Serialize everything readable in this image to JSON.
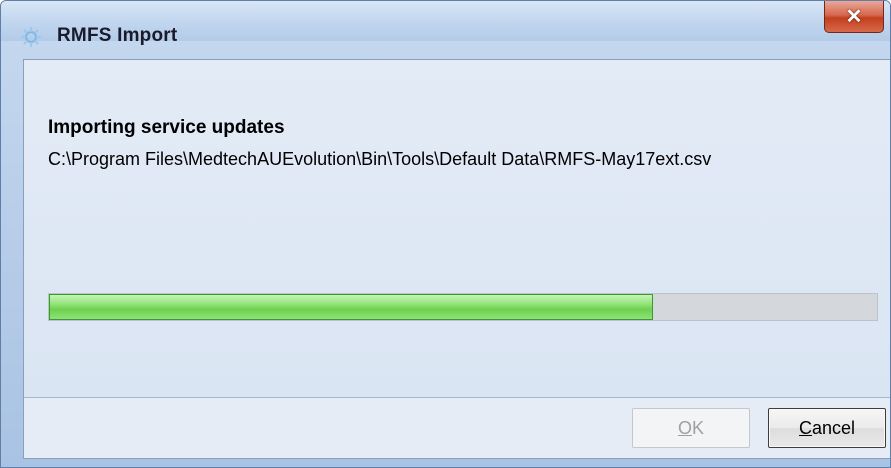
{
  "window": {
    "title": "RMFS Import",
    "close_label": "✕"
  },
  "status": {
    "heading": "Importing service updates",
    "file_path": "C:\\Program Files\\MedtechAUEvolution\\Bin\\Tools\\Default Data\\RMFS-May17ext.csv"
  },
  "progress": {
    "fraction": 0.73
  },
  "buttons": {
    "ok_mnemonic": "O",
    "ok_rest": "K",
    "cancel_mnemonic": "C",
    "cancel_rest": "ancel"
  },
  "icons": {
    "title": "gear-icon",
    "close": "close-icon"
  },
  "colors": {
    "progress_green": "#6ed14d",
    "close_red": "#c2401f"
  }
}
